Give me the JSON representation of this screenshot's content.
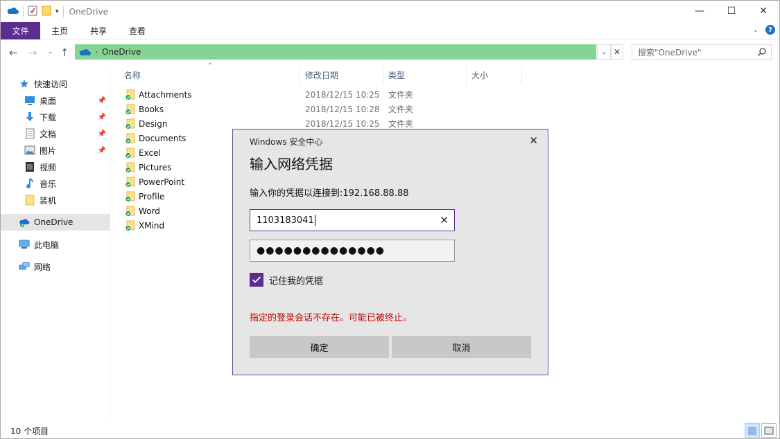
{
  "window": {
    "title": "OneDrive",
    "controls": {
      "minimize": "—",
      "maximize": "☐",
      "close": "✕"
    }
  },
  "ribbon": {
    "tabs": [
      "文件",
      "主页",
      "共享",
      "查看"
    ],
    "help": "?"
  },
  "address": {
    "crumb": "OneDrive",
    "search_placeholder": "搜索\"OneDrive\""
  },
  "nav": {
    "items": [
      {
        "label": "快速访问",
        "icon": "star-icon"
      },
      {
        "label": "桌面",
        "icon": "desktop-icon",
        "pinned": true
      },
      {
        "label": "下载",
        "icon": "download-icon",
        "pinned": true
      },
      {
        "label": "文档",
        "icon": "document-icon",
        "pinned": true
      },
      {
        "label": "图片",
        "icon": "picture-icon",
        "pinned": true
      },
      {
        "label": "视频",
        "icon": "video-icon"
      },
      {
        "label": "音乐",
        "icon": "music-icon"
      },
      {
        "label": "装机",
        "icon": "folder-icon"
      },
      {
        "label": "OneDrive",
        "icon": "onedrive-icon",
        "selected": true
      },
      {
        "label": "此电脑",
        "icon": "computer-icon"
      },
      {
        "label": "网络",
        "icon": "network-icon"
      }
    ]
  },
  "columns": {
    "name": "名称",
    "date": "修改日期",
    "type": "类型",
    "size": "大小"
  },
  "files": [
    {
      "name": "Attachments",
      "date": "2018/12/15 10:25",
      "type": "文件夹"
    },
    {
      "name": "Books",
      "date": "2018/12/15 10:28",
      "type": "文件夹"
    },
    {
      "name": "Design",
      "date": "2018/12/15 10:25",
      "type": "文件夹"
    },
    {
      "name": "Documents",
      "date": "",
      "type": ""
    },
    {
      "name": "Excel",
      "date": "",
      "type": ""
    },
    {
      "name": "Pictures",
      "date": "",
      "type": ""
    },
    {
      "name": "PowerPoint",
      "date": "",
      "type": ""
    },
    {
      "name": "Profile",
      "date": "",
      "type": ""
    },
    {
      "name": "Word",
      "date": "",
      "type": ""
    },
    {
      "name": "XMind",
      "date": "",
      "type": ""
    }
  ],
  "status": {
    "count": "10 个项目"
  },
  "dialog": {
    "header": "Windows 安全中心",
    "title": "输入网络凭据",
    "description": "输入你的凭据以连接到:192.168.88.88",
    "username": "1103183041",
    "password_mask": "●●●●●●●●●●●●●●",
    "remember_label": "记住我的凭据",
    "remember_checked": true,
    "error": "指定的登录会话不存在。可能已被终止。",
    "ok": "确定",
    "cancel": "取消"
  },
  "colors": {
    "accent": "#5c2d91",
    "address_bg": "#86d493",
    "error": "#c00000"
  }
}
